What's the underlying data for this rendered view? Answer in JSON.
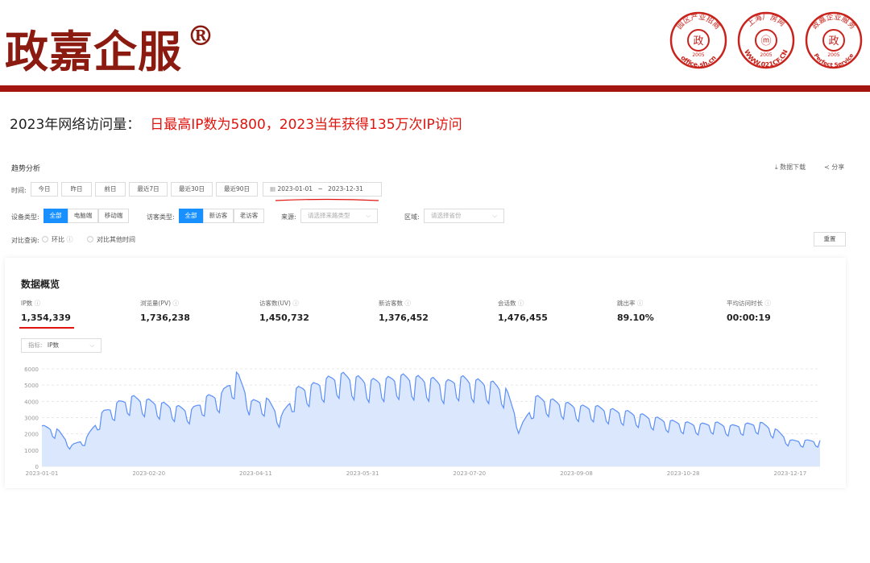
{
  "header": {
    "brand": "政嘉企服",
    "trademark": "®",
    "seals": [
      {
        "top_text": "园区产业招商",
        "center": "政",
        "year": "2005",
        "bottom_text": "office.sh.cn"
      },
      {
        "top_text": "上海厂房网",
        "center": "ⓜ",
        "year": "2005",
        "bottom_text": "WWW.021CF.CN"
      },
      {
        "top_text": "政嘉企业服务",
        "center": "政",
        "year": "2005",
        "bottom_text": "Perfect Service"
      }
    ]
  },
  "headline": {
    "prefix": "2023年网络访问量：",
    "highlight": "日最高IP数为5800，2023当年获得135万次IP访问"
  },
  "panel": {
    "title": "趋势分析",
    "download": "数据下载",
    "share": "分享",
    "time_label": "时间:",
    "time_buttons": [
      "今日",
      "昨日",
      "前日",
      "最近7日",
      "最近30日",
      "最近90日"
    ],
    "date_start": "2023-01-01",
    "date_sep": "~",
    "date_end": "2023-12-31",
    "device_label": "设备类型:",
    "device_buttons": [
      "全部",
      "电脑端",
      "移动端"
    ],
    "visitor_label": "访客类型:",
    "visitor_buttons": [
      "全部",
      "新访客",
      "老访客"
    ],
    "source_label": "来源:",
    "source_placeholder": "请选择来路类型",
    "region_label": "区域:",
    "region_placeholder": "请选择省份",
    "compare_label": "对比查询:",
    "compare_options": [
      "环比",
      "对比其他时间"
    ],
    "reset": "重置"
  },
  "overview": {
    "title": "数据概览",
    "metrics": [
      {
        "label": "IP数",
        "value": "1,354,339"
      },
      {
        "label": "浏览量(PV)",
        "value": "1,736,238"
      },
      {
        "label": "访客数(UV)",
        "value": "1,450,732"
      },
      {
        "label": "新访客数",
        "value": "1,376,452"
      },
      {
        "label": "会话数",
        "value": "1,476,455"
      },
      {
        "label": "跳出率",
        "value": "89.10%"
      },
      {
        "label": "平均访问时长",
        "value": "00:00:19"
      }
    ],
    "indicator_label": "指标:",
    "indicator_value": "IP数"
  },
  "chart_data": {
    "type": "area",
    "title": "",
    "xlabel": "",
    "ylabel": "",
    "ylim": [
      0,
      6000
    ],
    "yticks": [
      0,
      1000,
      2000,
      3000,
      4000,
      5000,
      6000
    ],
    "xtick_labels": [
      "2023-01-01",
      "2023-02-20",
      "2023-04-11",
      "2023-05-31",
      "2023-07-20",
      "2023-09-08",
      "2023-10-28",
      "2023-12-17"
    ],
    "series": [
      {
        "values_by_week": [
          2500,
          2300,
          1300,
          1800,
          3300,
          3900,
          4300,
          4100,
          3900,
          3700,
          3500,
          4300,
          4500,
          5800,
          4000,
          4200,
          3100,
          4800,
          5000,
          5400,
          5700,
          5500,
          5300,
          5400,
          5600,
          5500,
          5400,
          5200,
          5500,
          5300,
          5200,
          4800,
          2400,
          4300,
          4100,
          3900,
          3700,
          3700,
          3500,
          3400,
          3200,
          3000,
          2800,
          2700,
          2600,
          2700,
          2500,
          2600,
          2700,
          2300,
          1600
        ],
        "legend": "none"
      }
    ],
    "grid": true,
    "colors": {
      "line": "#5b8ff9",
      "fill": "#dbe7fc"
    }
  },
  "colors": {
    "brand": "#8b1a10",
    "bar": "#a5150f",
    "highlight": "#e0140e",
    "accent": "#1890ff"
  }
}
